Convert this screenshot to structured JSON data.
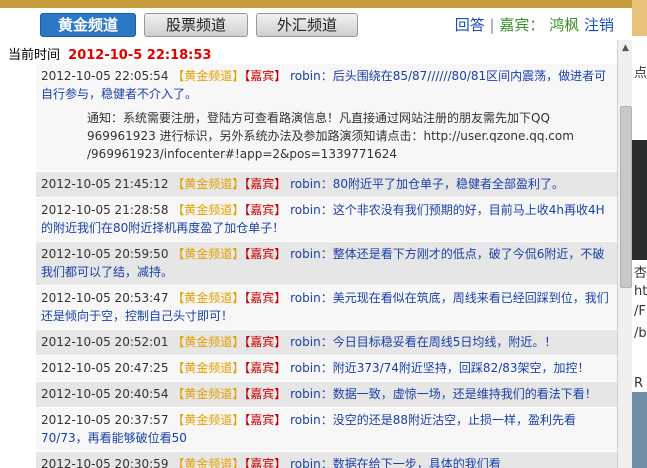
{
  "tabs": {
    "active": "黄金频道",
    "stock": "股票频道",
    "forex": "外汇频道"
  },
  "header_actions": {
    "reply": "回答",
    "sep1": "|",
    "guest_label": "嘉宾：",
    "guest_name": "鸿枫",
    "logout": "注销"
  },
  "current_time": {
    "label": "当前时间",
    "value": "2012-10-5 22:18:53"
  },
  "messages": [
    {
      "time": "2012-10-05 22:05:54",
      "channel": "【黄金频道】",
      "role": "【嘉宾】",
      "user": "robin",
      "text": "：后头围绕在85/87//////80/81区间内震荡，做进者可自行参与，稳健者不介入了。",
      "notice": {
        "line1": "通知：系统需要注册，登陆方可查看路演信息！凡直接通过网站注册的朋友需先加下QQ",
        "line2": "969961923 进行标识，另外系统办法及参加路演须知请点击：http://user.qzone.qq.com",
        "line3": "/969961923/infocenter#!app=2&pos=1339771624"
      }
    },
    {
      "time": "2012-10-05 21:45:12",
      "channel": "【黄金频道】",
      "role": "【嘉宾】",
      "user": "robin",
      "text": "：80附近平了加仓单子，稳健者全部盈利了。"
    },
    {
      "time": "2012-10-05 21:28:58",
      "channel": "【黄金频道】",
      "role": "【嘉宾】",
      "user": "robin",
      "text": "：这个非农没有我们预期的好，目前马上收4h再收4H的附近我们在80附近择机再度盈了加仓单子！"
    },
    {
      "time": "2012-10-05 20:59:50",
      "channel": "【黄金频道】",
      "role": "【嘉宾】",
      "user": "robin",
      "text": "：整体还是看下方刚才的低点，破了今侃6附近，不破我们都可以了结，减持。"
    },
    {
      "time": "2012-10-05 20:53:47",
      "channel": "【黄金频道】",
      "role": "【嘉宾】",
      "user": "robin",
      "text": "：美元现在看似在筑底，周线来看已经回踩到位，我们还是倾向于空，控制自己头寸即可！"
    },
    {
      "time": "2012-10-05 20:52:01",
      "channel": "【黄金频道】",
      "role": "【嘉宾】",
      "user": "robin",
      "text": "：今日目标稳妥看在周线5日均线，附近。！"
    },
    {
      "time": "2012-10-05 20:47:25",
      "channel": "【黄金频道】",
      "role": "【嘉宾】",
      "user": "robin",
      "text": "：附近373/74附近坚持，回踩82/83架空，加控！"
    },
    {
      "time": "2012-10-05 20:40:54",
      "channel": "【黄金频道】",
      "role": "【嘉宾】",
      "user": "robin",
      "text": "：数据一致，虚惊一场，还是维持我们的看法下看！"
    },
    {
      "time": "2012-10-05 20:37:57",
      "channel": "【黄金频道】",
      "role": "【嘉宾】",
      "user": "robin",
      "text": "：没空的还是88附近沽空，止损一样，盈利先看70/73，再看能够破位看50"
    },
    {
      "time": "2012-10-05 20:30:59",
      "channel": "【黄金频道】",
      "role": "【嘉宾】",
      "user": "robin",
      "text": "：数据在给下一步，具体的我们看"
    }
  ],
  "side": {
    "t1": "点",
    "t2": "杏",
    "t3": "ht",
    "t4": "/F",
    "t5": "/b",
    "t6": "R"
  }
}
